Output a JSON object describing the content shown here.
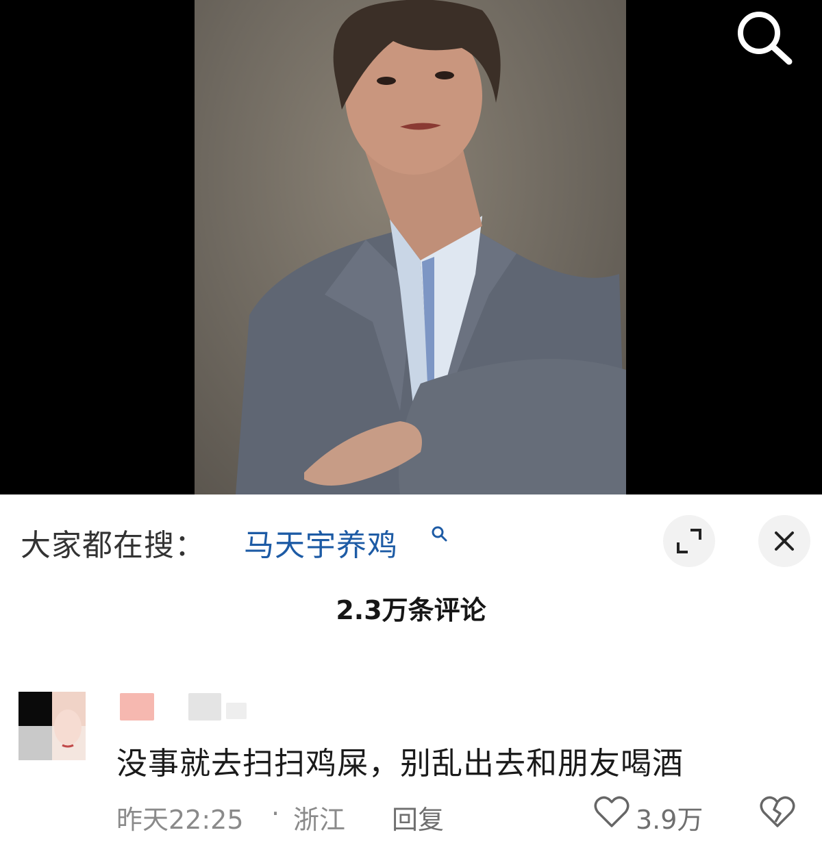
{
  "media": {
    "search_icon": "search-icon"
  },
  "trending": {
    "prefix": "大家都在搜：",
    "keyword": "马天宇养鸡",
    "keyword_icon": "search-small-icon",
    "expand_icon": "expand-icon",
    "close_icon": "close-icon",
    "keyword_color": "#1d5ba5"
  },
  "comments_header": {
    "count_label": "2.3万条评论"
  },
  "comment": {
    "text": "没事就去扫扫鸡屎，别乱出去和朋友喝酒",
    "time": "昨天22:25",
    "separator": "·",
    "location": "浙江",
    "reply_label": "回复",
    "likes": "3.9万",
    "like_icon": "heart-icon",
    "dislike_icon": "broken-heart-icon"
  }
}
